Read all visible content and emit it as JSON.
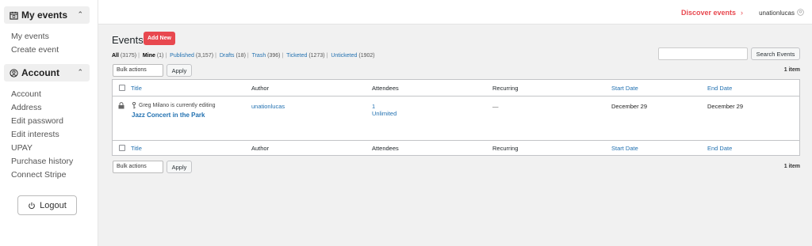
{
  "sidebar": {
    "sections": [
      {
        "title": "My events",
        "icon": "calendar-icon",
        "items": [
          "My events",
          "Create event"
        ]
      },
      {
        "title": "Account",
        "icon": "user-circle-icon",
        "items": [
          "Account",
          "Address",
          "Edit password",
          "Edit interests",
          "UPAY",
          "Purchase history",
          "Connect Stripe"
        ]
      }
    ],
    "logout_label": "Logout"
  },
  "topbar": {
    "discover_label": "Discover events",
    "username": "unationlucas"
  },
  "page": {
    "title": "Events",
    "add_new_label": "Add New",
    "filters": [
      {
        "label": "All",
        "count": "(3175)",
        "current": true
      },
      {
        "label": "Mine",
        "count": "(1)",
        "current": true
      },
      {
        "label": "Published",
        "count": "(3,157)",
        "current": false
      },
      {
        "label": "Drafts",
        "count": "(18)",
        "current": false
      },
      {
        "label": "Trash",
        "count": "(396)",
        "current": false
      },
      {
        "label": "Ticketed",
        "count": "(1273)",
        "current": false
      },
      {
        "label": "Unticketed",
        "count": "(1902)",
        "current": false
      }
    ],
    "search_button_label": "Search Events",
    "search_value": "",
    "bulk_actions_label": "Bulk actions",
    "apply_label": "Apply",
    "item_count": "1 item"
  },
  "table": {
    "columns": [
      "Title",
      "Author",
      "Attendees",
      "Recurring",
      "Start Date",
      "End Date"
    ],
    "rows": [
      {
        "editing_notice": "Greg Milano is currently editing",
        "title": "Jazz Concert in the Park",
        "author": "unationlucas",
        "attendees_count": "1",
        "attendees_limit": "Unlimited",
        "recurring": "—",
        "start_date": "December 29",
        "end_date": "December 29"
      }
    ]
  },
  "colors": {
    "accent": "#e8484f",
    "link": "#2271b1"
  }
}
